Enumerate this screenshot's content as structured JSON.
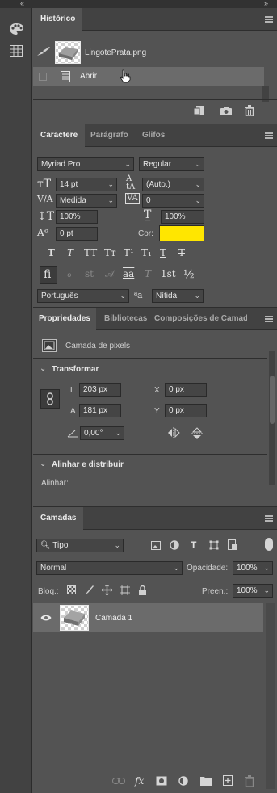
{
  "topbar": {
    "left_chevrons": "‹‹",
    "right_chevrons": "››"
  },
  "history": {
    "tab": "Histórico",
    "snapshot_name": "LingotePrata.png",
    "step": "Abrir"
  },
  "character": {
    "tabs": [
      "Caractere",
      "Parágrafo",
      "Glifos"
    ],
    "font_family": "Myriad Pro",
    "font_style": "Regular",
    "size": "14 pt",
    "leading": "(Auto.)",
    "kerning": "Medida",
    "tracking": "0",
    "vertical_scale": "100%",
    "horizontal_scale": "100%",
    "baseline_shift": "0 pt",
    "color_label": "Cor:",
    "color": "#ffe600",
    "style_buttons": [
      "T",
      "T",
      "TT",
      "Tᴛ",
      "T¹",
      "T₁",
      "T",
      "T"
    ],
    "opentype_buttons": [
      "fi",
      "ℴ",
      "st",
      "𝒜",
      "aa",
      "T",
      "1st",
      "½"
    ],
    "language": "Português",
    "aa_label": "ªa",
    "antialias": "Nítida"
  },
  "properties": {
    "tabs": [
      "Propriedades",
      "Bibliotecas",
      "Composições de Camada"
    ],
    "layer_type": "Camada de pixels",
    "transform_title": "Transformar",
    "L_label": "L",
    "L": "203 px",
    "A_label": "A",
    "A": "181 px",
    "X_label": "X",
    "X": "0 px",
    "Y_label": "Y",
    "Y": "0 px",
    "angle": "0,00°",
    "align_title": "Alinhar e distribuir",
    "align_label": "Alinhar:"
  },
  "layers": {
    "tab": "Camadas",
    "filter": "Tipo",
    "blend_mode": "Normal",
    "opacity_label": "Opacidade:",
    "opacity": "100%",
    "lock_label": "Bloq.:",
    "fill_label": "Preen.:",
    "fill": "100%",
    "layer_name": "Camada 1",
    "footer_fx": "fx"
  }
}
